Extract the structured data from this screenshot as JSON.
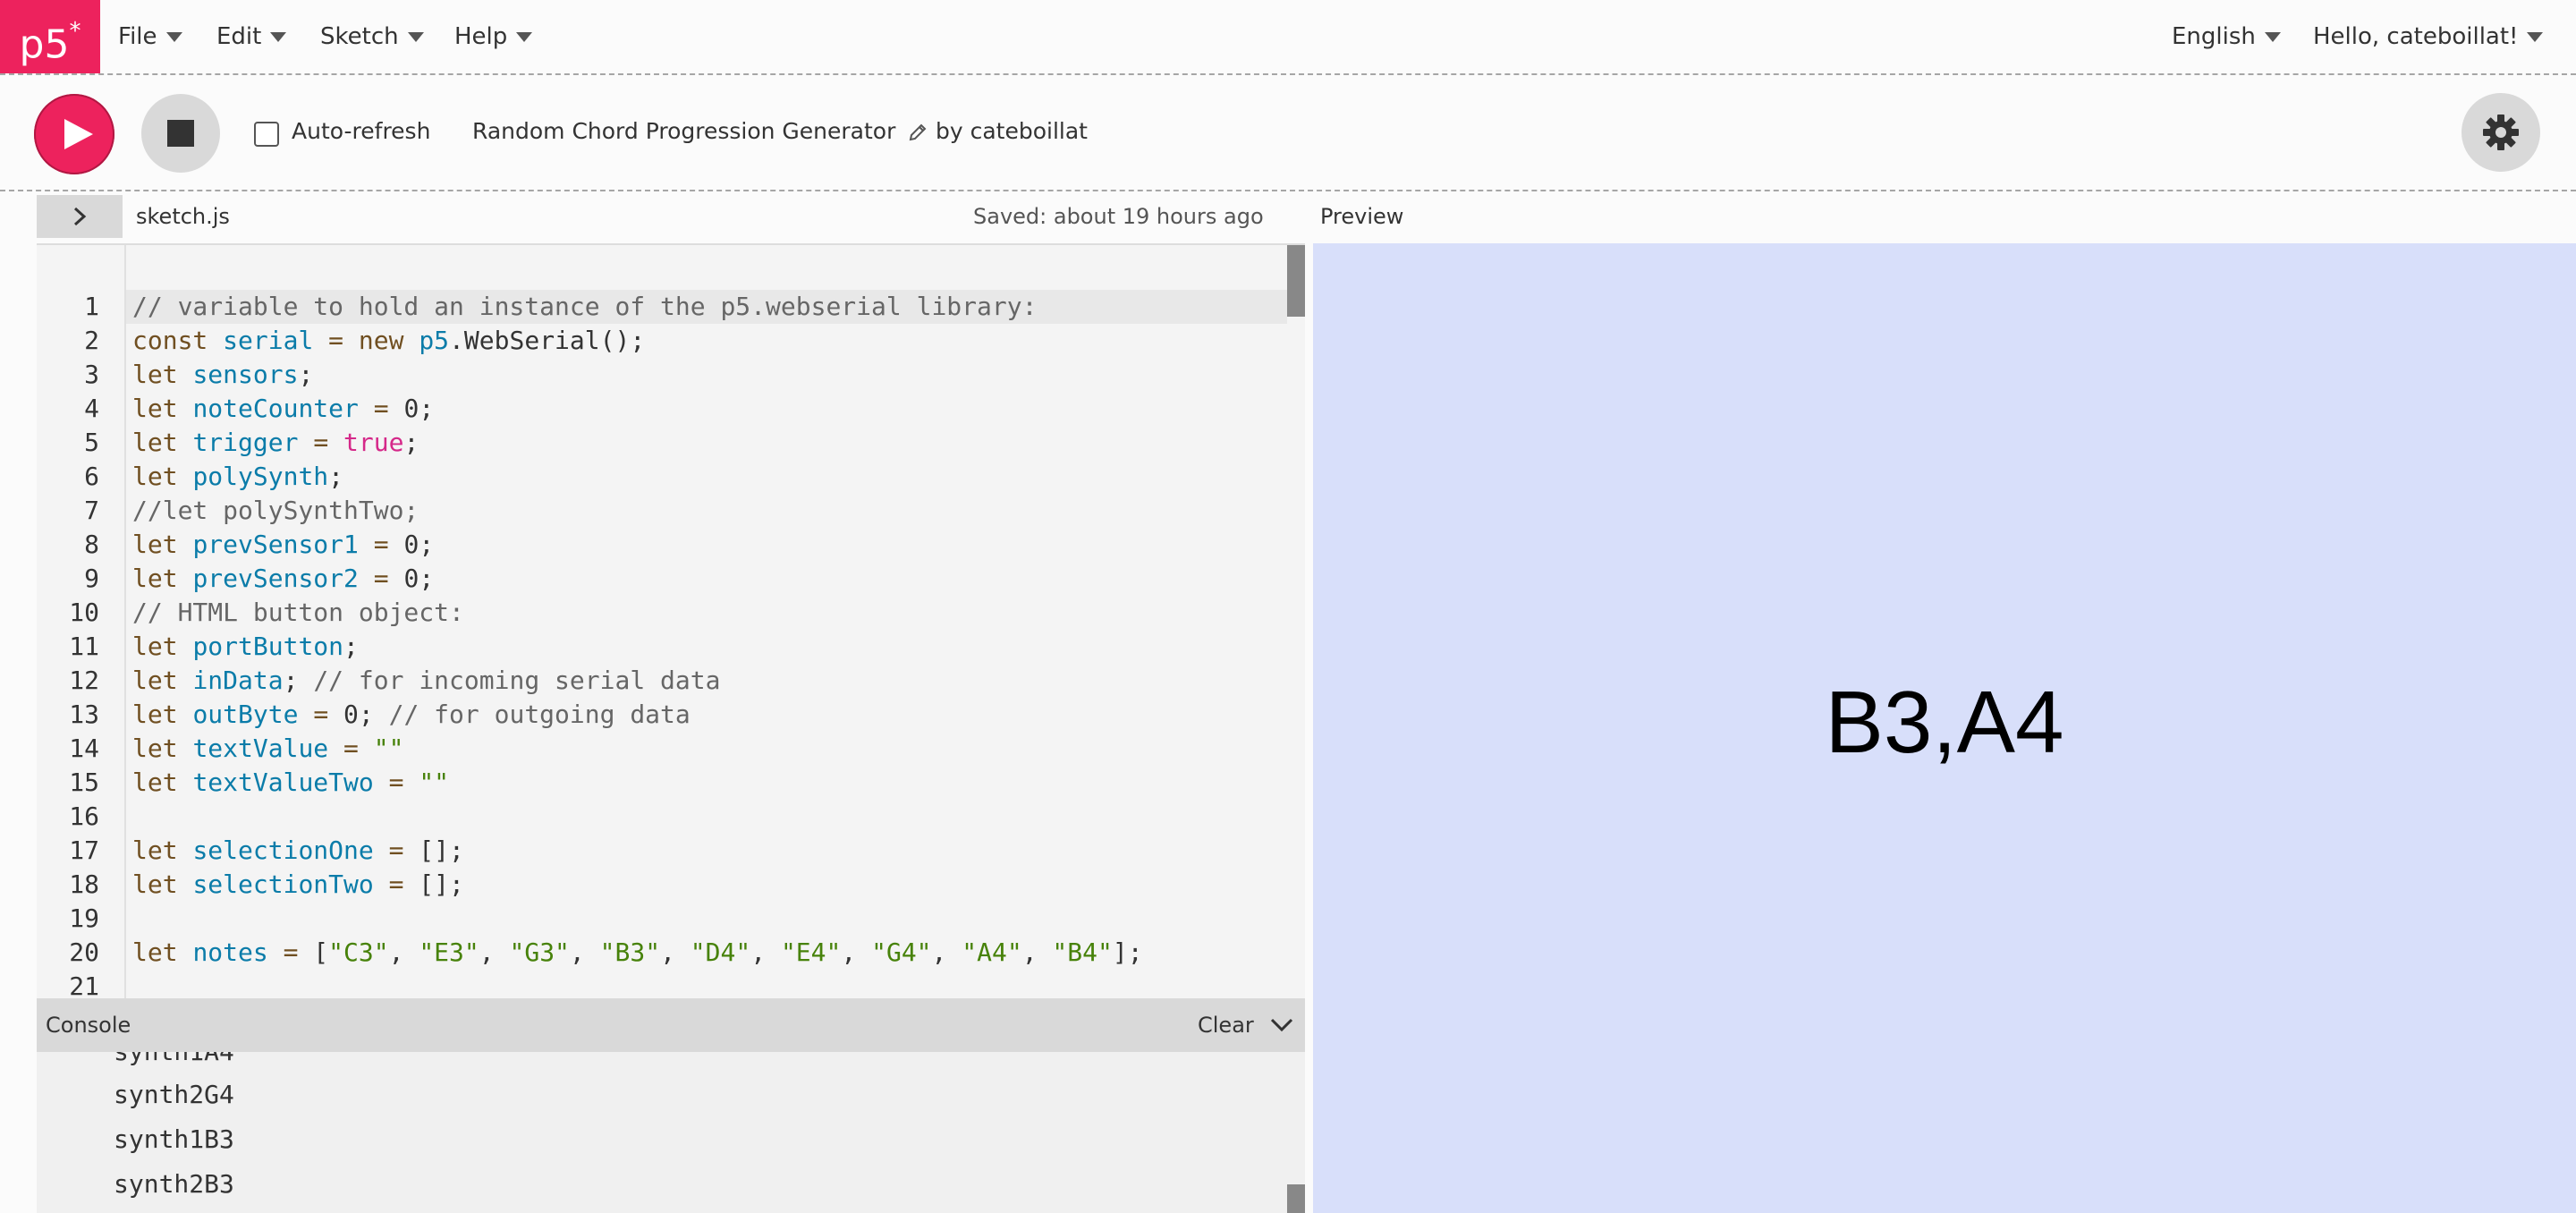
{
  "nav": {
    "logo": "p5",
    "logo_star": "*",
    "menus": [
      "File",
      "Edit",
      "Sketch",
      "Help"
    ],
    "language": "English",
    "user": "Hello, cateboillat!"
  },
  "toolbar": {
    "autorefresh_label": "Auto-refresh",
    "autorefresh_checked": false,
    "sketch_name": "Random Chord Progression Generator",
    "author": "by cateboillat"
  },
  "editor": {
    "file_name": "sketch.js",
    "saved_status": "Saved: about 19 hours ago",
    "line_numbers": [
      "1",
      "2",
      "3",
      "4",
      "5",
      "6",
      "7",
      "8",
      "9",
      "10",
      "11",
      "12",
      "13",
      "14",
      "15",
      "16",
      "17",
      "18",
      "19",
      "20",
      "21"
    ],
    "lines": [
      "// variable to hold an instance of the p5.webserial library:",
      "const serial = new p5.WebSerial();",
      "let sensors;",
      "let noteCounter = 0;",
      "let trigger = true;",
      "let polySynth;",
      "//let polySynthTwo;",
      "let prevSensor1 = 0;",
      "let prevSensor2 = 0;",
      "// HTML button object:",
      "let portButton;",
      "let inData; // for incoming serial data",
      "let outByte = 0; // for outgoing data",
      "let textValue = \"\"",
      "let textValueTwo = \"\"",
      "",
      "let selectionOne = [];",
      "let selectionTwo = [];",
      "",
      "let notes = [\"C3\", \"E3\", \"G3\", \"B3\", \"D4\", \"E4\", \"G4\", \"A4\", \"B4\"];",
      ""
    ]
  },
  "console": {
    "title": "Console",
    "clear_label": "Clear",
    "lines": [
      "synth1A4",
      "synth2G4",
      "synth1B3",
      "synth2B3"
    ]
  },
  "preview": {
    "label": "Preview",
    "canvas_text": "B3,A4",
    "background_color": "#d8dffa"
  },
  "colors": {
    "accent": "#ed225d",
    "comment": "#666666",
    "keyword": "#704f21",
    "variable": "#0b7ca9",
    "string": "#47820a",
    "boolean": "#d52889"
  },
  "icons": [
    "play-icon",
    "stop-icon",
    "pencil-icon",
    "gear-icon",
    "chevron-right-icon",
    "chevron-down-icon",
    "caret-down-icon"
  ]
}
